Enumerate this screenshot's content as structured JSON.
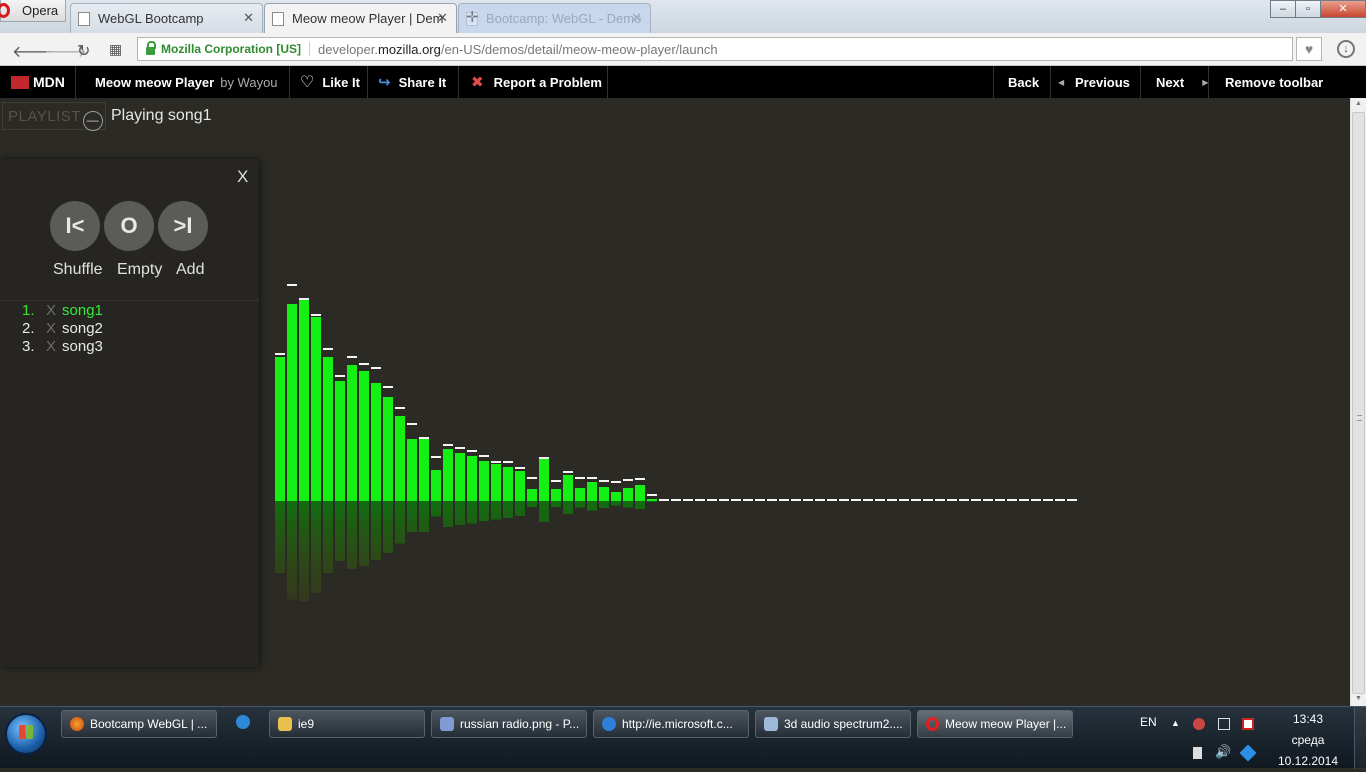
{
  "browser": {
    "app_name": "Opera",
    "tabs": [
      {
        "title": "WebGL Bootcamp",
        "active": false
      },
      {
        "title": "Meow meow Player | Dem",
        "active": true
      },
      {
        "title": "Bootcamp: WebGL - Demo",
        "active": false
      }
    ],
    "window_buttons": {
      "minimize": "–",
      "maximize": "▫",
      "close": "✕"
    },
    "address": {
      "identity": "Mozilla Corporation [US]",
      "url_prefix": "developer.",
      "url_domain": "mozilla.org",
      "url_path": "/en-US/demos/detail/meow-meow-player/launch"
    }
  },
  "mdn_toolbar": {
    "logo": "MDN",
    "demo_title": "Meow meow Player",
    "author": "by Wayou",
    "like": "Like It",
    "share": "Share It",
    "report": "Report a Problem",
    "back": "Back",
    "previous": "Previous",
    "next": "Next",
    "remove": "Remove toolbar"
  },
  "player": {
    "playlist_button": "PLAYLIST",
    "status": "Playing song1",
    "panel_close": "X",
    "controls": [
      {
        "symbol": "I<",
        "label": "Shuffle"
      },
      {
        "symbol": "O",
        "label": "Empty"
      },
      {
        "symbol": ">I",
        "label": "Add"
      }
    ],
    "songs": [
      {
        "num": "1.",
        "remove": "X",
        "name": "song1",
        "active": true
      },
      {
        "num": "2.",
        "remove": "X",
        "name": "song2",
        "active": false
      },
      {
        "num": "3.",
        "remove": "X",
        "name": "song3",
        "active": false
      }
    ]
  },
  "spectrum": {
    "values": [
      144,
      197,
      201,
      184,
      144,
      120,
      136,
      130,
      118,
      104,
      85,
      62,
      62,
      31,
      52,
      48,
      45,
      40,
      37,
      34,
      30,
      12,
      42,
      12,
      26,
      13,
      19,
      14,
      9,
      13,
      16,
      2,
      0,
      0,
      0,
      0,
      0,
      0,
      0,
      0,
      0,
      0,
      0,
      0,
      0,
      0,
      0,
      0,
      0,
      0,
      0,
      0,
      0,
      0,
      0,
      0,
      0,
      0,
      0,
      0,
      0,
      0,
      0,
      0,
      0,
      0,
      0
    ],
    "caps": [
      146,
      215,
      201,
      185,
      151,
      124,
      143,
      136,
      132,
      113,
      92,
      76,
      62,
      43,
      55,
      52,
      49,
      44,
      38,
      38,
      32,
      22,
      42,
      19,
      28,
      22,
      22,
      19,
      18,
      20,
      21,
      5,
      0,
      0,
      0,
      0,
      0,
      0,
      0,
      0,
      0,
      0,
      0,
      0,
      0,
      0,
      0,
      0,
      0,
      0,
      0,
      0,
      0,
      0,
      0,
      0,
      0,
      0,
      0,
      0,
      0,
      0,
      0,
      0,
      0,
      0,
      0
    ]
  },
  "taskbar": {
    "items": [
      {
        "label": "Bootcamp WebGL | ...",
        "icon": "firefox-icon"
      },
      {
        "label": "ie9",
        "icon": "folder-icon"
      },
      {
        "label": "russian radio.png - P...",
        "icon": "paint-icon"
      },
      {
        "label": "http://ie.microsoft.c...",
        "icon": "ie-icon"
      },
      {
        "label": "3d audio spectrum2....",
        "icon": "image-viewer-icon"
      },
      {
        "label": "Meow meow Player |...",
        "icon": "opera-icon"
      }
    ],
    "language": "EN",
    "time": "13:43",
    "weekday": "среда",
    "date": "10.12.2014"
  }
}
